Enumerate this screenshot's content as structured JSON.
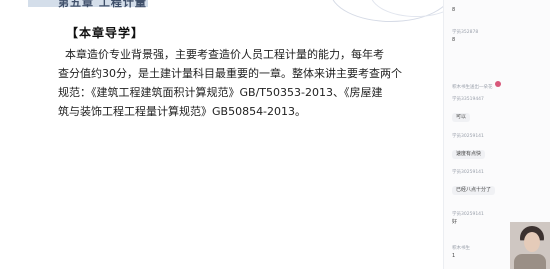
{
  "slide": {
    "header_title": "第五章 工程计量",
    "section_heading": "【本章导学】",
    "body_lines": [
      "本章造价专业背景强，主要考查造价人员工程计量的能力，每年考",
      "查分值约30分，是土建计量科目最重要的一章。整体来讲主要考查两个",
      "规范：《建筑工程建筑面积计算规范》GB/T50353-2013、《房屋建",
      "筑与装饰工程工程量计算规范》GB50854-2013。"
    ]
  },
  "chat": {
    "messages": [
      {
        "name": "",
        "text": "8",
        "style": "bare"
      },
      {
        "name": "学员352878",
        "text": "8",
        "style": "bare"
      },
      {
        "name": "积木书生送出一朵花",
        "text": "",
        "style": "gift"
      },
      {
        "name": "学员33519447",
        "text": "可以",
        "style": "bubble"
      },
      {
        "name": "学员30259141",
        "text": "速度有点快",
        "style": "bubble"
      },
      {
        "name": "学员30259141",
        "text": "已经八点十分了",
        "style": "bubble"
      },
      {
        "name": "学员30259141",
        "text": "好",
        "style": "bare"
      },
      {
        "name": "积木书生",
        "text": "1",
        "style": "bare"
      }
    ]
  }
}
